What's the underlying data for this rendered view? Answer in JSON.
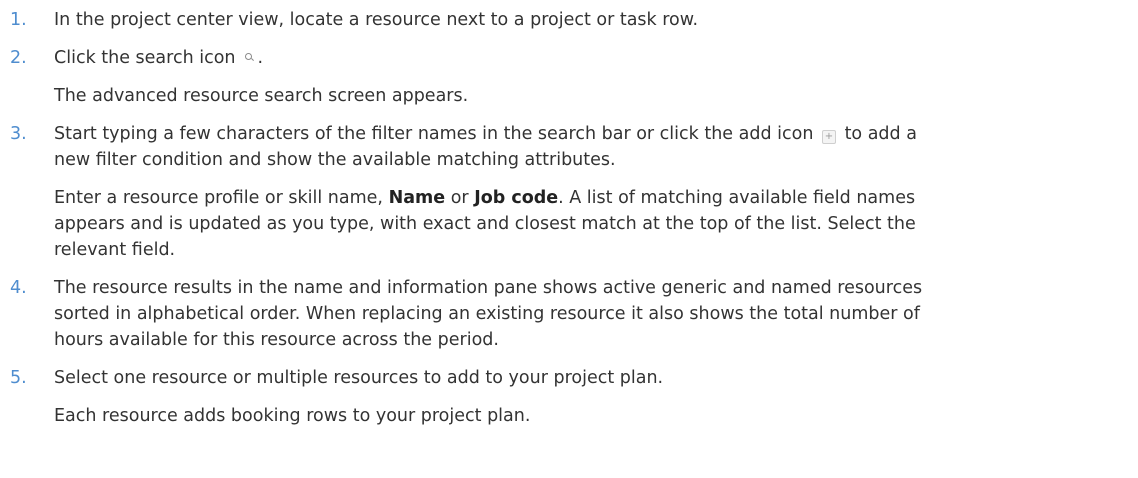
{
  "steps": [
    {
      "number": "1.",
      "lines": [
        "In the project center view, locate a resource next to a project or task row."
      ]
    },
    {
      "number": "2.",
      "before_icon": "Click the search icon",
      "after_icon": ".",
      "icon": "search-icon",
      "note": "The advanced resource search screen appears."
    },
    {
      "number": "3.",
      "line1_before_icon": "Start typing a few characters of the filter names in the search bar or click the add icon",
      "line1_after_icon": "to add a",
      "icon": "add-icon",
      "line2": "new filter condition and show the available matching attributes.",
      "para_line1_a": "Enter a resource profile or skill name,",
      "para_bold1": "Name",
      "para_line1_b": "or",
      "para_bold2": "Job code",
      "para_line1_c": ". A list of matching available field names",
      "para_line2": "appears and is updated as you type, with exact and closest match at the top of the list. Select the",
      "para_line3": "relevant field."
    },
    {
      "number": "4.",
      "lines": [
        "The resource results in the name and information pane shows active generic and named resources",
        "sorted in alphabetical order. When replacing an existing resource it also shows the total number of",
        "hours available for this resource across the period."
      ]
    },
    {
      "number": "5.",
      "lines": [
        "Select one resource or multiple resources to add to your project plan."
      ],
      "note": "Each resource adds booking rows to your project plan."
    }
  ],
  "colors": {
    "step_number": "#4f8dcf",
    "body_text": "#333333"
  }
}
